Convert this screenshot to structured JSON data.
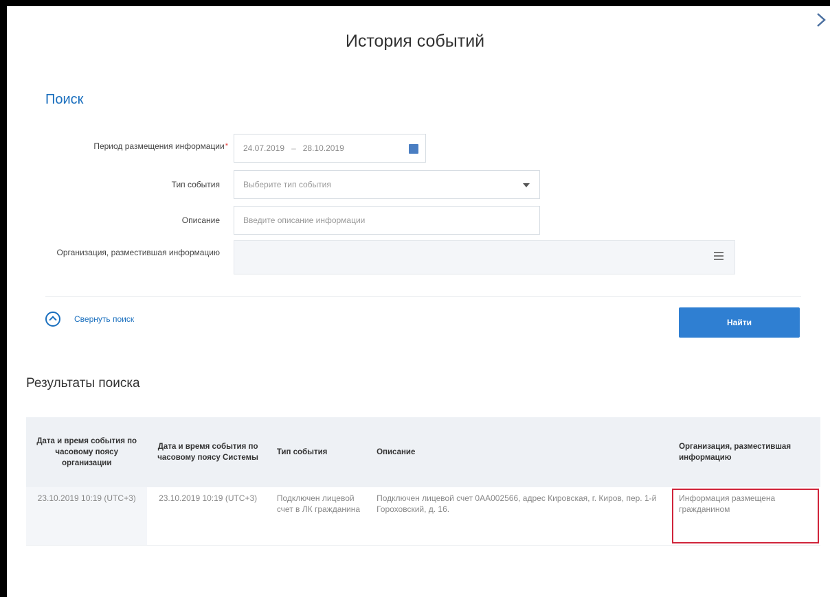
{
  "modal": {
    "title": "История событий"
  },
  "search": {
    "heading": "Поиск",
    "period_label": "Период размещения информации",
    "period_required_mark": "*",
    "date_from": "24.07.2019",
    "date_separator": "–",
    "date_to": "28.10.2019",
    "event_type_label": "Тип события",
    "event_type_placeholder": "Выберите тип события",
    "description_label": "Описание",
    "description_placeholder": "Введите описание информации",
    "org_label": "Организация, разместившая информацию",
    "collapse_label": "Свернуть поиск",
    "find_button": "Найти"
  },
  "results": {
    "title": "Результаты поиска",
    "columns": [
      "Дата и время события по часовому поясу организации",
      "Дата и время события по часовому поясу Системы",
      "Тип события",
      "Описание",
      "Организация, разместившая информацию"
    ],
    "rows": [
      {
        "org_time": "23.10.2019 10:19 (UTC+3)",
        "system_time": "23.10.2019 10:19 (UTC+3)",
        "event_type": "Подключен лицевой счет в ЛК гражданина",
        "description": "Подключен лицевой счет 0АА002566, адрес Кировская, г. Киров, пер. 1-й Гороховский, д. 16.",
        "organization": "Информация размещена гражданином"
      }
    ]
  },
  "colors": {
    "accent": "#1a6fbe",
    "button": "#2f7fd2",
    "highlight": "#d0243a"
  },
  "icons": {
    "close": "chevron-right-icon",
    "calendar": "calendar-icon",
    "dropdown": "caret-down-icon",
    "list": "hamburger-icon",
    "collapse": "chevron-up-circle-icon"
  }
}
